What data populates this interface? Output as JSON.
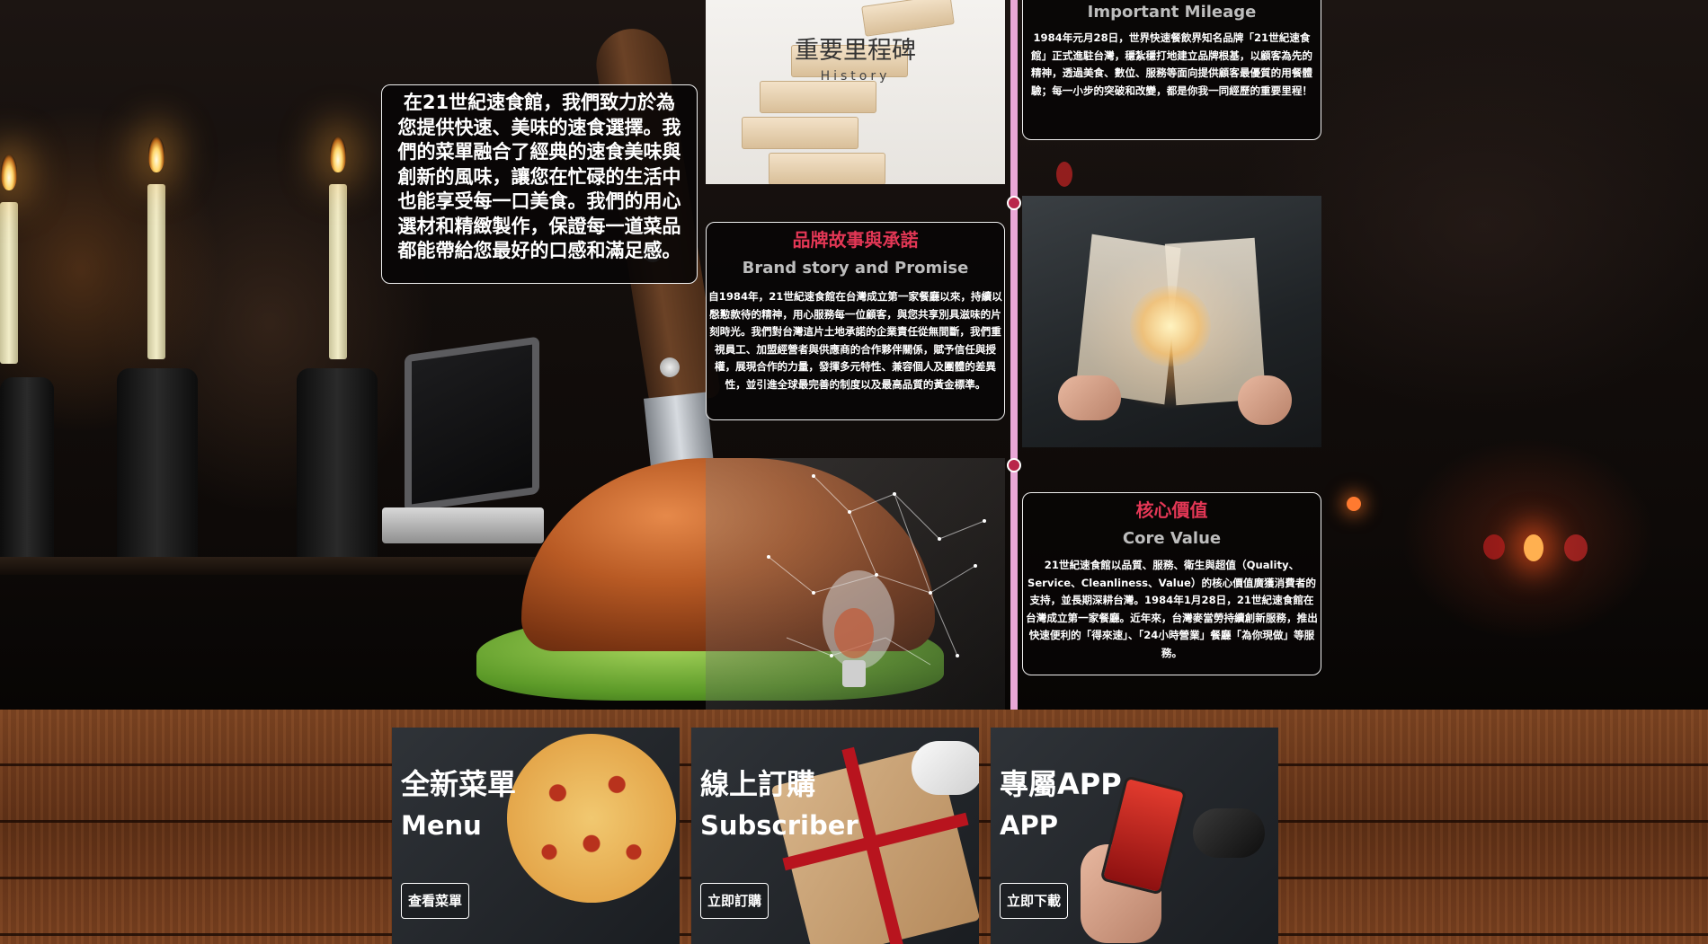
{
  "intro": {
    "text": "在21世紀速食館，我們致力於為您提供快速、美味的速食選擇。我們的菜單融合了經典的速食美味與創新的風味，讓您在忙碌的生活中也能享受每一口美食。我們的用心選材和精緻製作，保證每一道菜品都能帶給您最好的口感和滿足感。"
  },
  "history": {
    "title": "重要里程碑",
    "subtitle": "History"
  },
  "brand_story": {
    "title": "品牌故事與承諾",
    "subtitle": "Brand story and Promise",
    "body": "自1984年，21世紀速食館在台灣成立第一家餐廳以來，持續以慇懃款待的精神，用心服務每一位顧客，與您共享別具滋味的片刻時光。我們對台灣這片土地承諾的企業責任從無間斷，我們重視員工、加盟經營者與供應商的合作夥伴關係，賦予信任與授權，展現合作的力量，發揮多元特性、兼容個人及團體的差異性，並引進全球最完善的制度以及最高品質的黃金標準。"
  },
  "mileage": {
    "title": "Important Mileage",
    "body": "1984年元月28日，世界快速餐飲界知名品牌「21世紀速食館」正式進駐台灣，穩紮穩打地建立品牌根基，以顧客為先的精神，透過美食、數位、服務等面向提供顧客最優質的用餐體驗；每一小步的突破和改變，都是你我一同經歷的重要里程！"
  },
  "core_value": {
    "title": "核心價值",
    "subtitle": "Core Value",
    "body": "21世紀速食館以品質、服務、衛生與超值（Quality、Service、Cleanliness、Value）的核心價值廣獲消費者的支持，並長期深耕台灣。1984年1月28日，21世紀速食館在台灣成立第一家餐廳。近年來，台灣麥當勞持續創新服務，推出快速便利的「得來速」、「24小時營業」餐廳「為你現做」等服務。"
  },
  "promos": [
    {
      "title": "全新菜單",
      "subtitle": "Menu",
      "button": "查看菜單",
      "image": "pizza"
    },
    {
      "title": "線上訂購",
      "subtitle": "Subscriber",
      "button": "立即訂購",
      "image": "pizza-box-gift"
    },
    {
      "title": "專屬APP",
      "subtitle": "APP",
      "button": "立即下載",
      "image": "phone-app"
    }
  ],
  "colors": {
    "accent_red": "#e33755",
    "timeline_pink": "#e9a7d6",
    "subtitle_gray": "#bdbdbd"
  }
}
